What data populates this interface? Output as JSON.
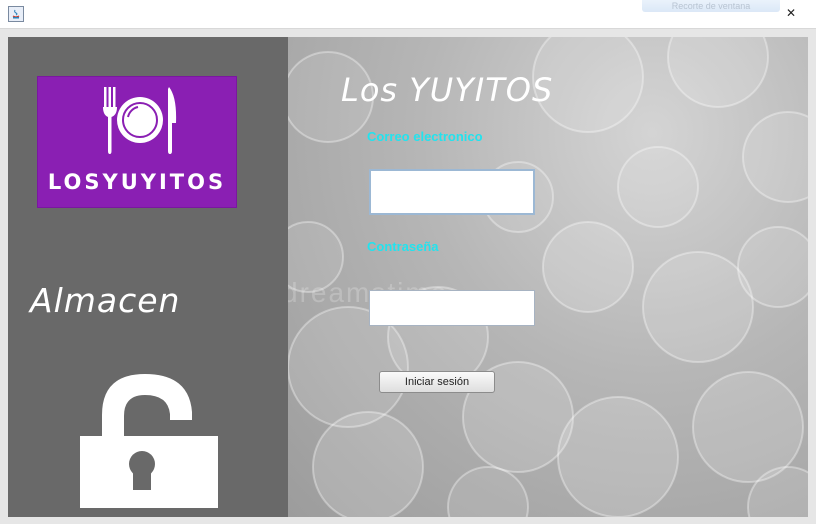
{
  "window": {
    "close_glyph": "✕",
    "ghost_label": "Recorte de ventana"
  },
  "left": {
    "brand_logo_text": "LOSYUYITOS",
    "section_title": "Almacen",
    "logo_color": "#8a1fb3"
  },
  "form": {
    "app_title": "Los YUYITOS",
    "email_label": "Correo electronico",
    "email_value": "",
    "password_label": "Contraseña",
    "password_value": "",
    "login_button": "Iniciar sesión",
    "label_color": "#22e3ee"
  },
  "watermark": "dreamstime"
}
